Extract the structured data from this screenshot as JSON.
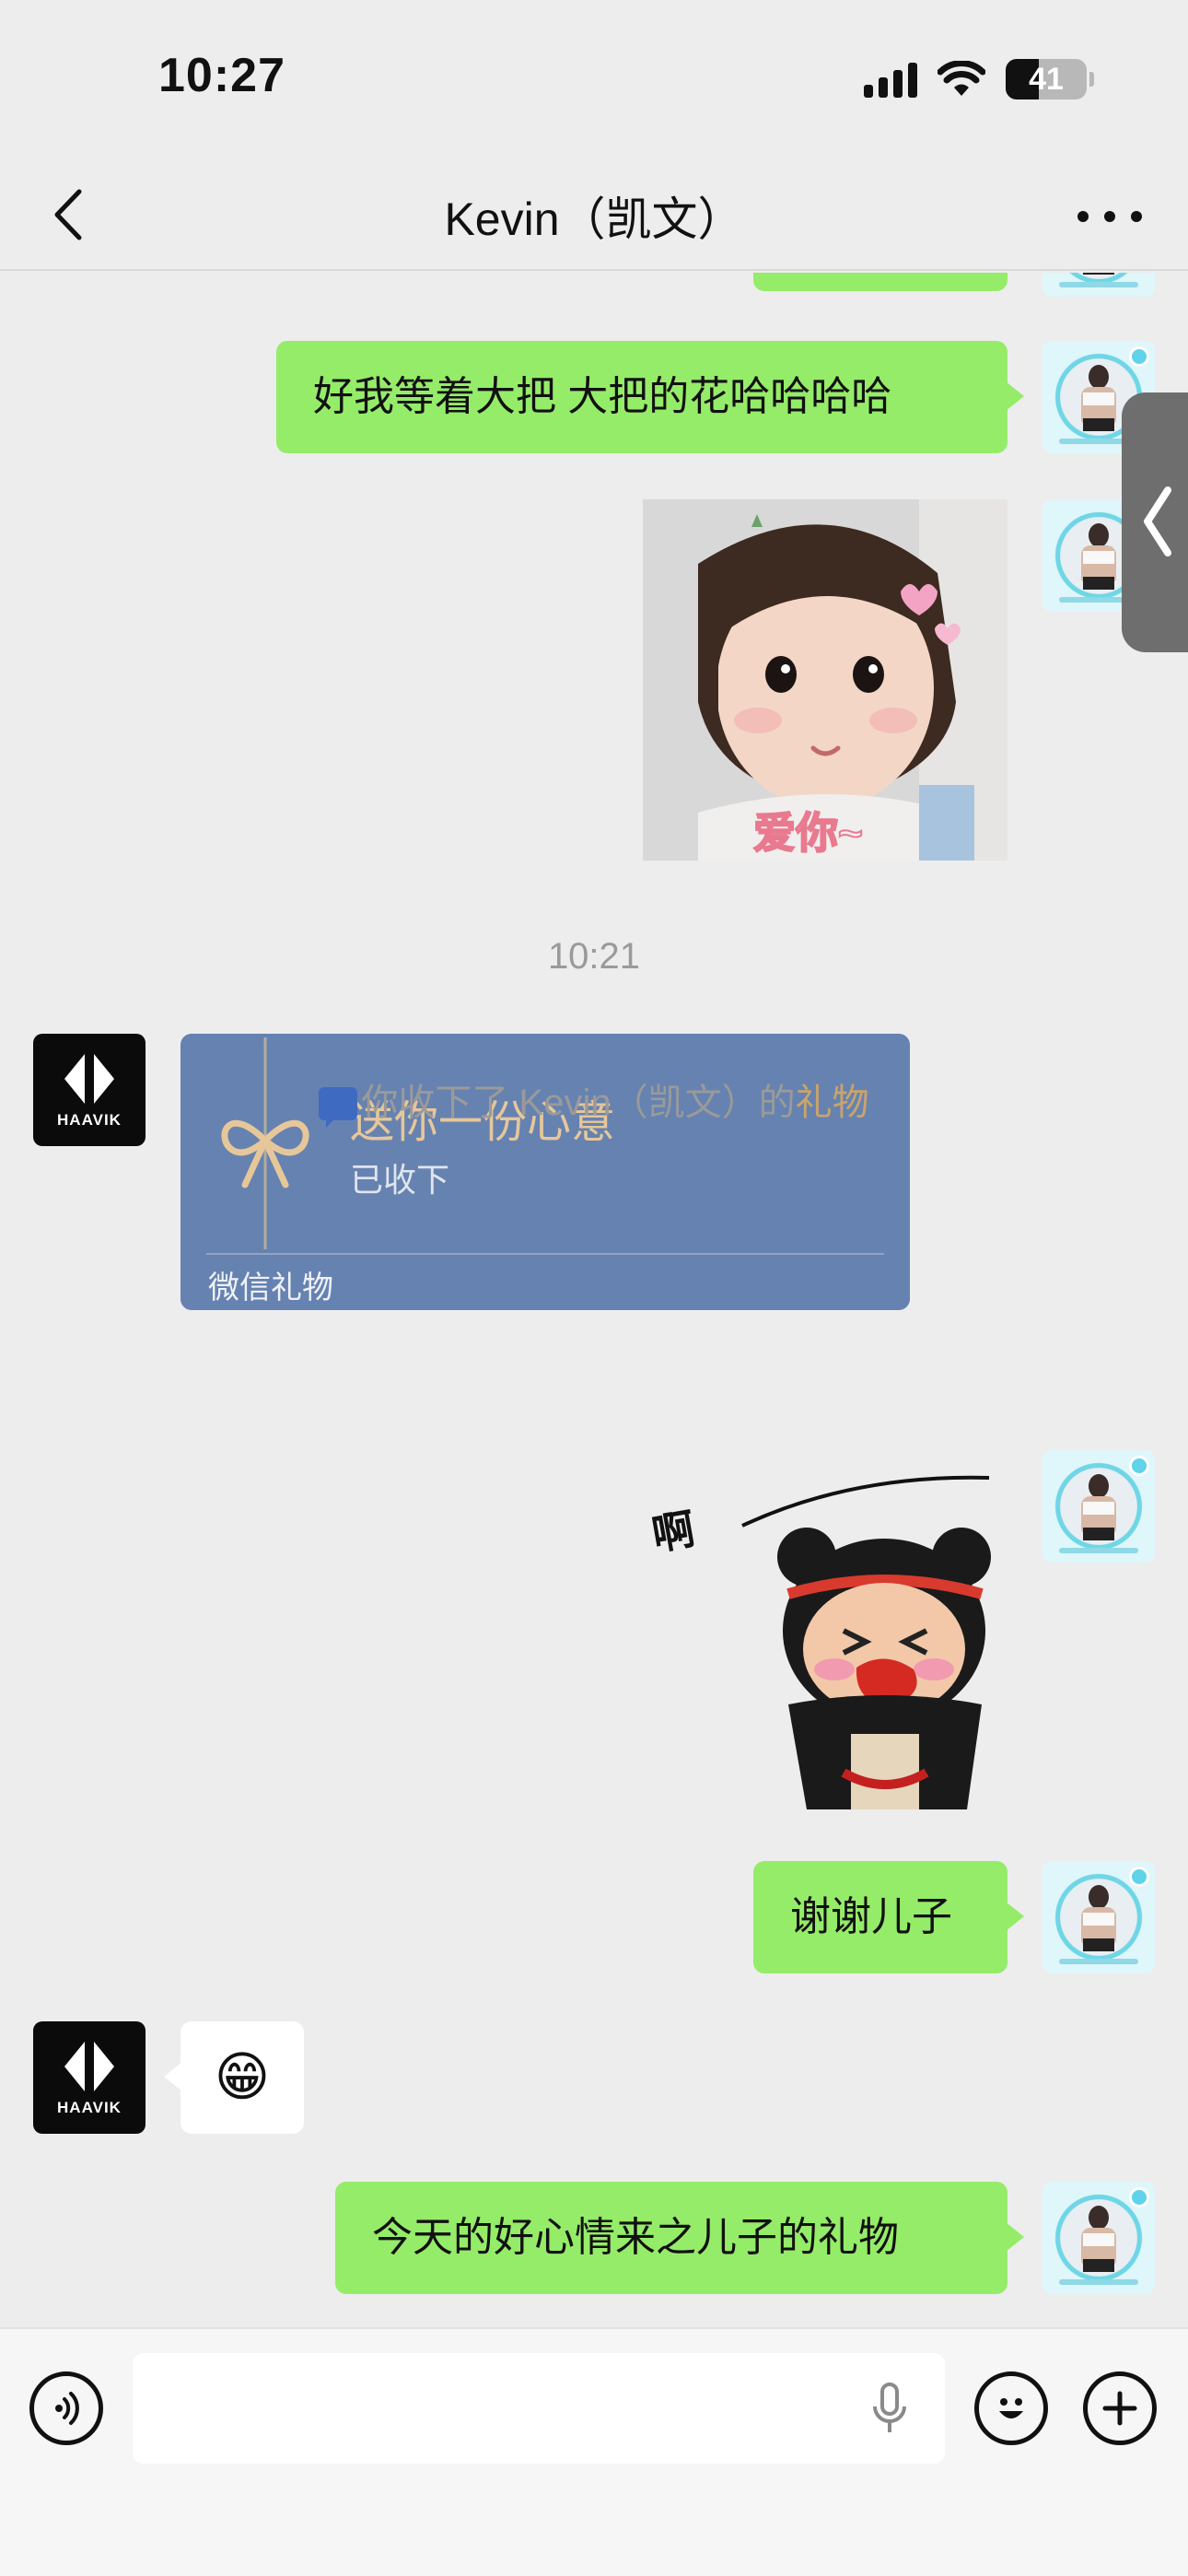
{
  "status_bar": {
    "time": "10:27",
    "battery": "41"
  },
  "nav": {
    "title": "Kevin（凯文）"
  },
  "messages": {
    "msg1": "好我等着大把 大把的花哈哈哈哈",
    "photo_caption": "爱你~",
    "time_divider": "10:21",
    "gift": {
      "title": "送你一份心意",
      "status": "已收下",
      "footer": "微信礼物"
    },
    "system_notice": {
      "prefix": "你收下了 Kevin（凯文）的",
      "link": "礼物"
    },
    "sticker_text": "啊",
    "msg2": "谢谢儿子",
    "emoji_reply": "😁",
    "msg3": "今天的好心情来之儿子的礼物"
  },
  "avatars": {
    "haavik_brand": "HAAVIK"
  },
  "input": {
    "placeholder": ""
  },
  "colors": {
    "bubble_green": "#95ec69",
    "gift_card": "#6682b0",
    "gift_gold": "#e6c79a",
    "link_gold": "#c9a46c"
  }
}
